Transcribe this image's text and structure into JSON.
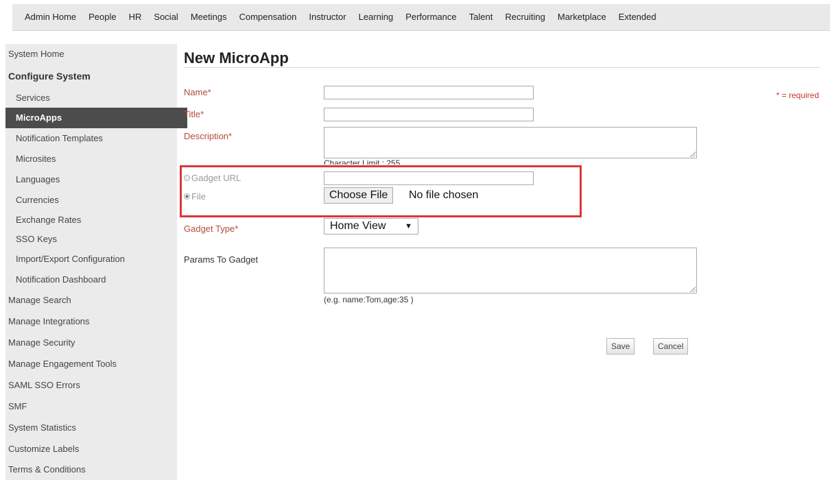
{
  "nav": {
    "items": [
      "Admin Home",
      "People",
      "HR",
      "Social",
      "Meetings",
      "Compensation",
      "Instructor",
      "Learning",
      "Performance",
      "Talent",
      "Recruiting",
      "Marketplace",
      "Extended"
    ]
  },
  "sidebar": {
    "items": [
      {
        "label": "System Home"
      },
      {
        "label": "Configure System"
      },
      {
        "label": "Services"
      },
      {
        "label": "MicroApps"
      },
      {
        "label": "Notification Templates"
      },
      {
        "label": "Microsites"
      },
      {
        "label": "Languages"
      },
      {
        "label": "Currencies"
      },
      {
        "label": "Exchange Rates"
      },
      {
        "label": "SSO Keys"
      },
      {
        "label": "Import/Export Configuration"
      },
      {
        "label": "Notification Dashboard"
      },
      {
        "label": "Manage Search"
      },
      {
        "label": "Manage Integrations"
      },
      {
        "label": "Manage Security"
      },
      {
        "label": "Manage Engagement Tools"
      },
      {
        "label": "SAML SSO Errors"
      },
      {
        "label": "SMF"
      },
      {
        "label": "System Statistics"
      },
      {
        "label": "Customize Labels"
      },
      {
        "label": "Terms & Conditions"
      }
    ]
  },
  "page": {
    "title": "New MicroApp",
    "required_note": "* = required"
  },
  "form": {
    "name_label": "Name*",
    "name_value": "",
    "title_label": "Title*",
    "title_value": "",
    "description_label": "Description*",
    "description_value": "",
    "char_limit": "Character Limit : 255",
    "gadget_url_label": "Gadget URL",
    "gadget_url_value": "",
    "file_label": "File",
    "choose_file_label": "Choose File",
    "no_file_text": "No file chosen",
    "gadget_type_label": "Gadget Type*",
    "gadget_type_value": "Home View",
    "params_label": "Params To Gadget",
    "params_value": "",
    "params_hint": "(e.g. name:Tom,age:35 )",
    "save_label": "Save",
    "cancel_label": "Cancel"
  },
  "colors": {
    "required_label": "#b34a3a",
    "highlight_box": "#d9363e",
    "sidebar_active_bg": "#4c4c4c"
  }
}
